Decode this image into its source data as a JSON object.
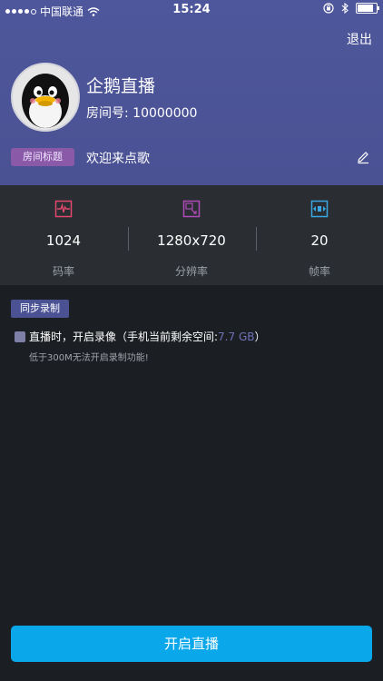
{
  "status_bar": {
    "carrier": "中国联通",
    "time": "15:24"
  },
  "header": {
    "logout_label": "退出",
    "room_name": "企鹅直播",
    "room_id_text": "房间号: 10000000",
    "title_tag": "房间标题",
    "title_text": "欢迎来点歌"
  },
  "stats": [
    {
      "value": "1024",
      "label": "码率",
      "icon": "waveform-icon",
      "color": "#e04a6a"
    },
    {
      "value": "1280x720",
      "label": "分辨率",
      "icon": "resize-icon",
      "color": "#b04ab8"
    },
    {
      "value": "20",
      "label": "帧率",
      "icon": "framerate-icon",
      "color": "#3aa8e0"
    }
  ],
  "record": {
    "section_tag": "同步录制",
    "label_prefix": "直播时，开启录像（手机当前剩余空间:",
    "free_space": "7.7 GB",
    "label_suffix": "）",
    "note": "低于300M无法开启录制功能!"
  },
  "start_button": "开启直播"
}
